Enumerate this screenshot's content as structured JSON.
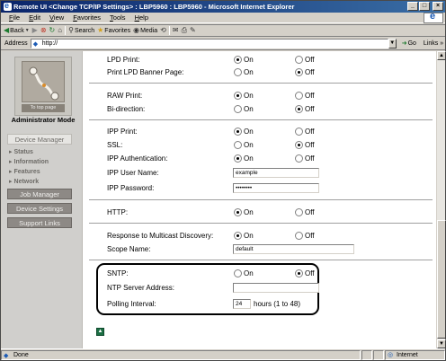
{
  "window": {
    "title": "Remote UI <Change TCP/IP Settings> : LBP5960 : LBP5960 - Microsoft Internet Explorer",
    "min": "_",
    "max": "□",
    "close": "×"
  },
  "menu": [
    "File",
    "Edit",
    "View",
    "Favorites",
    "Tools",
    "Help"
  ],
  "toolbar": {
    "back": "Back",
    "search": "Search",
    "favorites": "Favorites",
    "media": "Media"
  },
  "address": {
    "label": "Address",
    "url": "http://",
    "go": "Go",
    "links": "Links »"
  },
  "nav": {
    "logo_caption": "To top page",
    "admin_mode": "Administrator Mode",
    "device_manager": "Device Manager",
    "subs": [
      "Status",
      "Information",
      "Features",
      "Network"
    ],
    "job_manager": "Job Manager",
    "device_settings": "Device Settings",
    "support_links": "Support Links"
  },
  "labels": {
    "on": "On",
    "off": "Off"
  },
  "form": {
    "lpd_print": "LPD Print:",
    "lpd_banner": "Print LPD Banner Page:",
    "raw_print": "RAW Print:",
    "bi_direction": "Bi-direction:",
    "ipp_print": "IPP Print:",
    "ssl": "SSL:",
    "ipp_auth": "IPP Authentication:",
    "ipp_user": "IPP User Name:",
    "ipp_user_value": "example",
    "ipp_password": "IPP Password:",
    "ipp_password_value": "••••••••",
    "http": "HTTP:",
    "multicast": "Response to Multicast Discovery:",
    "scope_name": "Scope Name:",
    "scope_value": "default",
    "sntp": "SNTP:",
    "ntp_address": "NTP Server Address:",
    "ntp_value": "",
    "polling": "Polling Interval:",
    "polling_value": "24",
    "polling_unit": "hours (1 to 48)"
  },
  "status": {
    "text": "Done",
    "zone": "Internet"
  }
}
